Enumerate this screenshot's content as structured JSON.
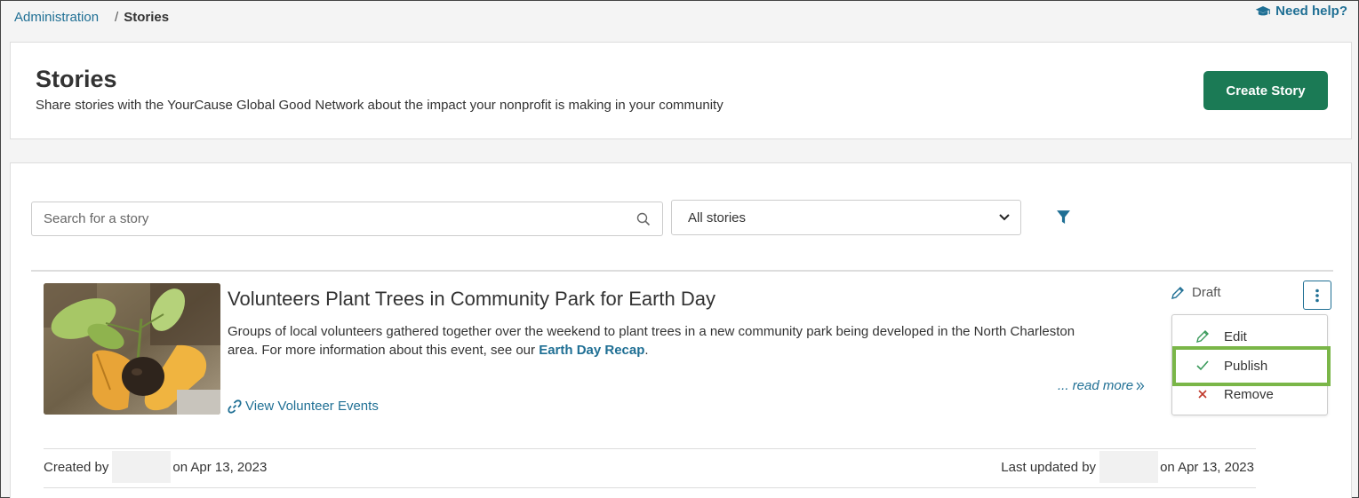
{
  "breadcrumb": {
    "parent": "Administration",
    "separator": "/",
    "current": "Stories"
  },
  "help": {
    "label": "Need help?"
  },
  "header": {
    "title": "Stories",
    "subtitle": "Share stories with the YourCause Global Good Network about the impact your nonprofit is making in your community",
    "create_button": "Create Story"
  },
  "filters": {
    "search_placeholder": "Search for a story",
    "search_value": "",
    "select_value": "All stories"
  },
  "story": {
    "title": "Volunteers Plant Trees in Community Park for Earth Day",
    "description_prefix": "Groups of local volunteers gathered together over the weekend to plant trees in a new community park being developed in the North Charleston area. For more information about this event, see our ",
    "description_link": "Earth Day Recap",
    "description_suffix": ".",
    "read_more": "... read more",
    "view_events": "View Volunteer Events",
    "status": "Draft",
    "created_prefix": "Created by",
    "created_suffix": "on Apr 13, 2023",
    "updated_prefix": "Last updated by",
    "updated_suffix": "on Apr 13, 2023"
  },
  "menu": {
    "items": [
      {
        "label": "Edit",
        "icon": "pencil-icon"
      },
      {
        "label": "Publish",
        "icon": "check-icon"
      },
      {
        "label": "Remove",
        "icon": "x-icon"
      }
    ]
  },
  "colors": {
    "brand_green": "#1b7a55",
    "link_blue": "#1f6f94",
    "highlight_green": "#7ab648",
    "remove_red": "#c0392b",
    "check_green": "#3a9a5b"
  }
}
